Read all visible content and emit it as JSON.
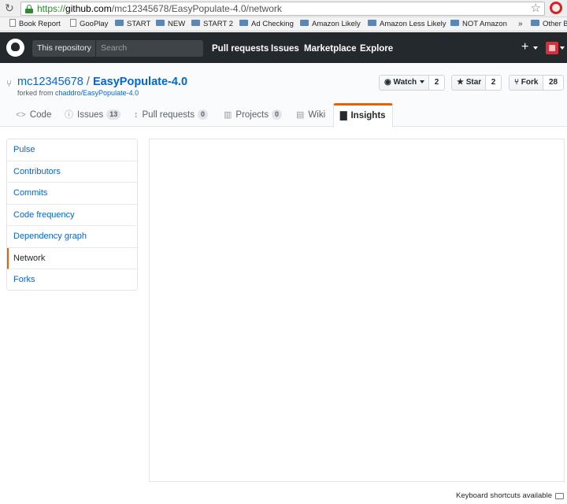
{
  "browser": {
    "url_proto": "https://",
    "url_host": "github.com",
    "url_path": "/mc12345678/EasyPopulate-4.0/network"
  },
  "bookmarks": {
    "items": [
      "Book Report",
      "GooPlay",
      "START",
      "NEW",
      "START 2",
      "Ad Checking",
      "Amazon Likely",
      "Amazon Less Likely",
      "NOT Amazon"
    ],
    "more": "»",
    "other": "Other Bo"
  },
  "header": {
    "scope_label": "This repository",
    "search_placeholder": "Search",
    "nav": [
      "Pull requests",
      "Issues",
      "Marketplace",
      "Explore"
    ],
    "plus": "+"
  },
  "repo": {
    "owner": "mc12345678",
    "separator": " / ",
    "name": "EasyPopulate-4.0",
    "forked_prefix": "forked from ",
    "forked_source": "chaddro/EasyPopulate-4.0",
    "watch_label": "Watch",
    "watch_count": "2",
    "star_label": "Star",
    "star_count": "2",
    "fork_label": "Fork",
    "fork_count": "28"
  },
  "tabs": [
    {
      "label": "Code",
      "icon": "<>"
    },
    {
      "label": "Issues",
      "badge": "13"
    },
    {
      "label": "Pull requests",
      "badge": "0"
    },
    {
      "label": "Projects",
      "badge": "0"
    },
    {
      "label": "Wiki"
    },
    {
      "label": "Insights"
    }
  ],
  "sidebar": {
    "items": [
      "Pulse",
      "Contributors",
      "Commits",
      "Code frequency",
      "Dependency graph",
      "Network",
      "Forks"
    ]
  },
  "footer": {
    "keyboard_shortcuts": "Keyboard shortcuts available"
  },
  "colors": {
    "header_bg": "#24292e",
    "link": "#0366d6",
    "active_accent": "#e36209"
  }
}
